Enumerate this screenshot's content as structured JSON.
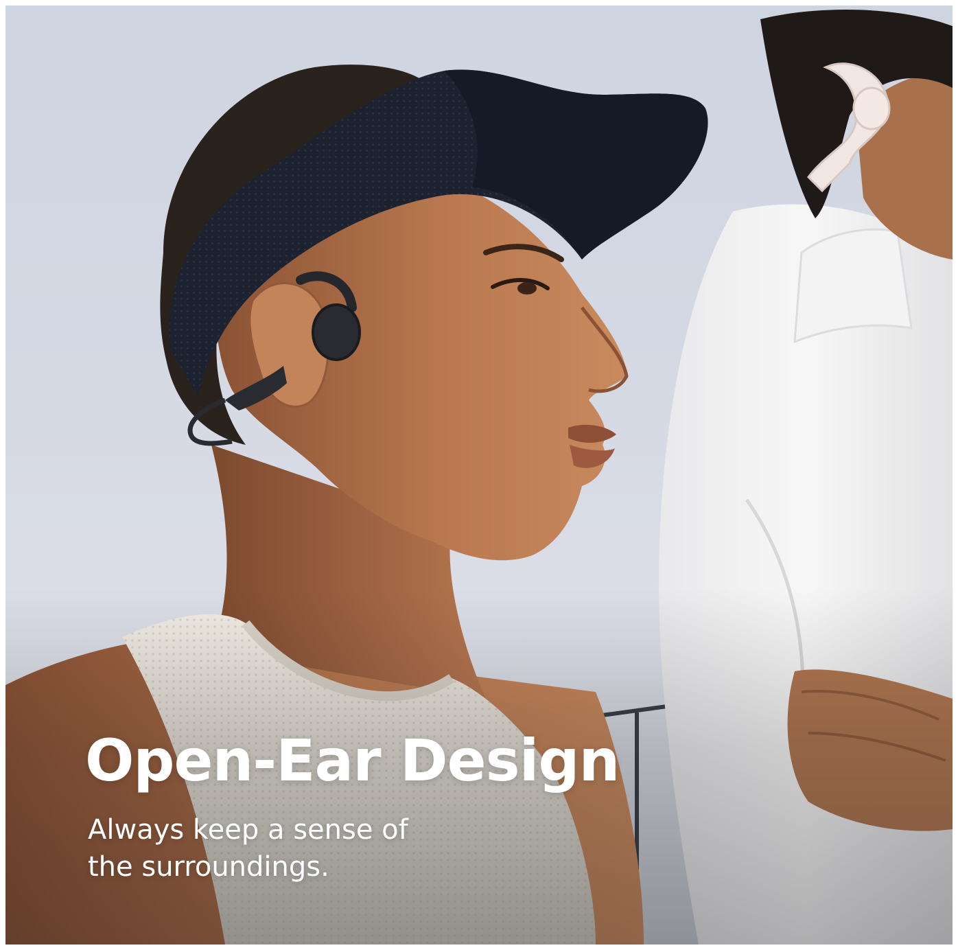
{
  "promo": {
    "headline": "Open-Ear Design",
    "subtext_line1": "Always keep a sense of",
    "subtext_line2": "the surroundings."
  },
  "photo": {
    "subject": "woman-wearing-black-open-ear-headphones-and-visor",
    "secondary_subject": "person-in-white-shirt-wearing-white-open-ear-headphones",
    "colors": {
      "sky": "#d3d7e2",
      "skin": "#b9784f",
      "visor": "#1c2130",
      "headphone": "#2a2b30",
      "tank_top": "#ece7de",
      "white_shirt": "#f5f5f5"
    }
  }
}
